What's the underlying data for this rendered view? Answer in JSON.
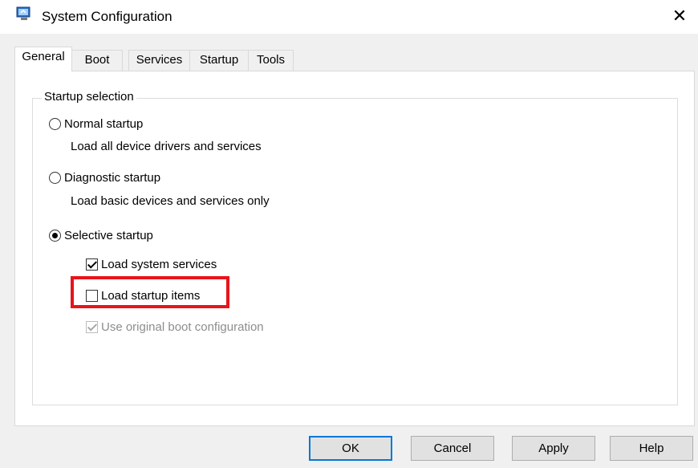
{
  "window": {
    "title": "System Configuration",
    "close_glyph": "✕",
    "icon": "system-configuration-icon"
  },
  "tabs": [
    {
      "label": "General",
      "active": true
    },
    {
      "label": "Boot",
      "active": false
    },
    {
      "label": "Services",
      "active": false
    },
    {
      "label": "Startup",
      "active": false
    },
    {
      "label": "Tools",
      "active": false
    }
  ],
  "startup_selection": {
    "legend": "Startup selection",
    "options": [
      {
        "label": "Normal startup",
        "description": "Load all device drivers and services",
        "selected": false
      },
      {
        "label": "Diagnostic startup",
        "description": "Load basic devices and services only",
        "selected": false
      },
      {
        "label": "Selective startup",
        "description": "",
        "selected": true
      }
    ],
    "selective_items": [
      {
        "label": "Load system services",
        "checked": true,
        "enabled": true
      },
      {
        "label": "Load startup items",
        "checked": false,
        "enabled": true
      },
      {
        "label": "Use original boot configuration",
        "checked": true,
        "enabled": false
      }
    ]
  },
  "buttons": {
    "ok": "OK",
    "cancel": "Cancel",
    "apply": "Apply",
    "help": "Help"
  },
  "colors": {
    "highlight": "#e8141b",
    "default_button_border": "#0078d7"
  }
}
